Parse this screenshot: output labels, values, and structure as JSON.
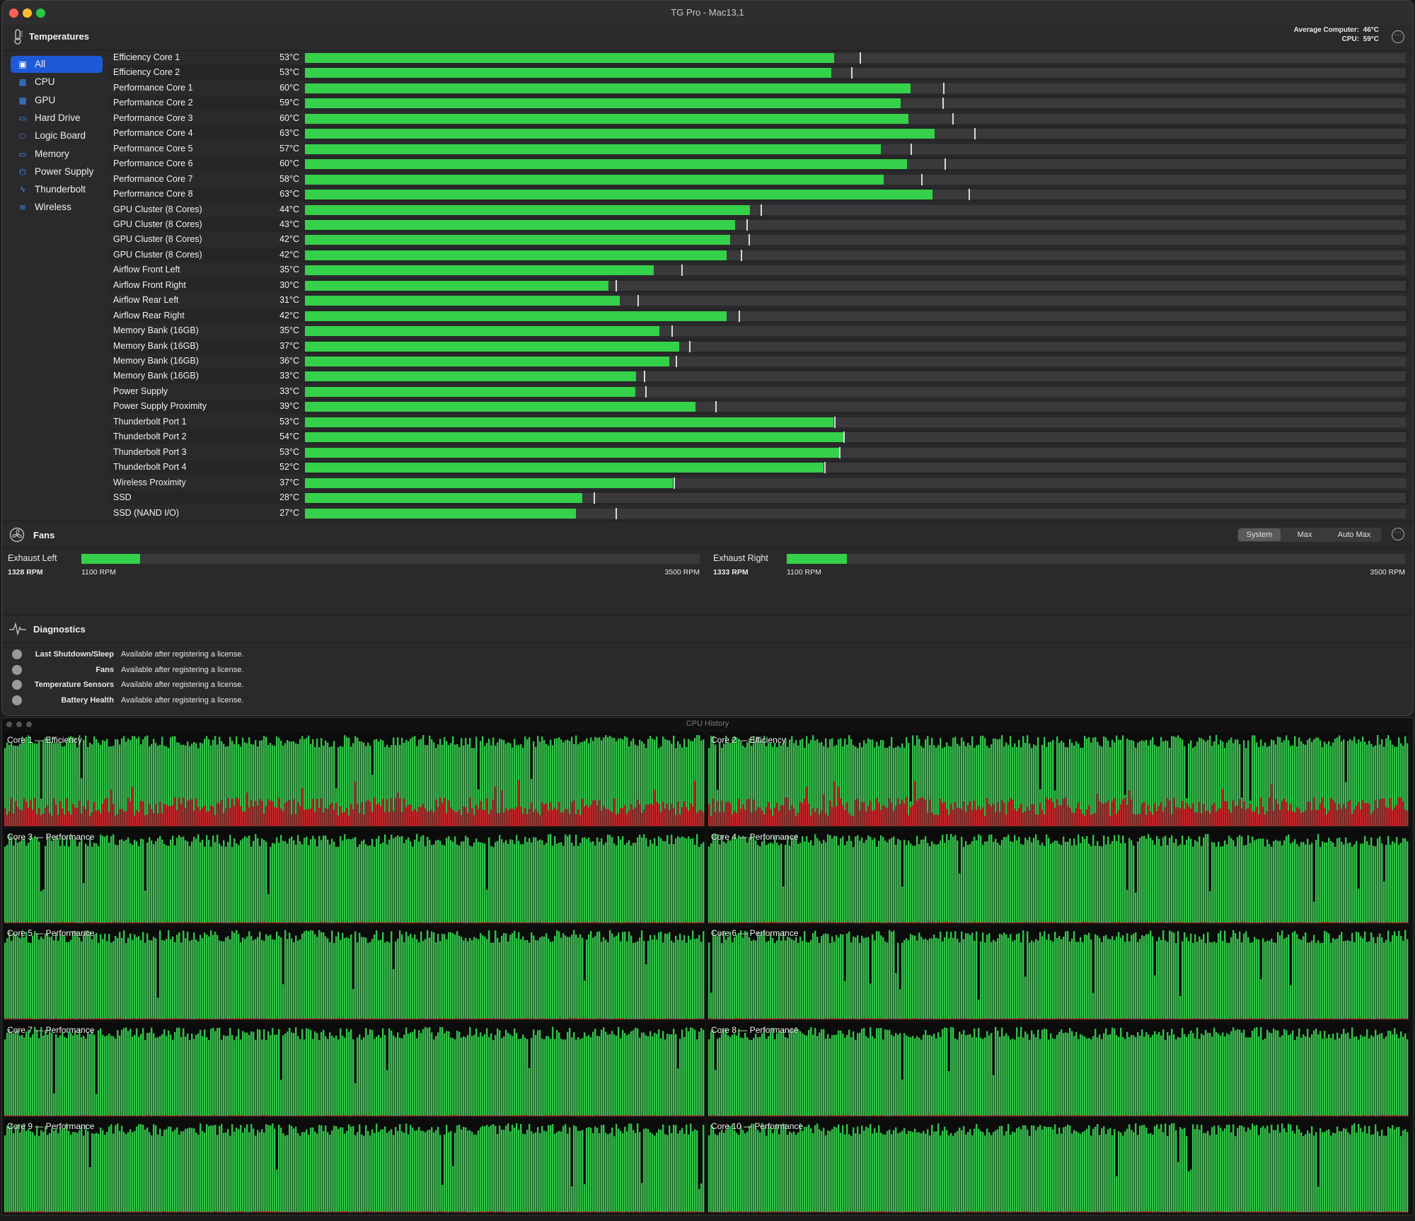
{
  "window": {
    "title": "TG Pro - Mac13,1"
  },
  "temperatures": {
    "header": "Temperatures",
    "avg_computer_label": "Average Computer:",
    "avg_computer_value": "46°C",
    "cpu_label": "CPU:",
    "cpu_value": "59°C",
    "categories": [
      {
        "label": "All",
        "icon": "all-icon",
        "selected": true
      },
      {
        "label": "CPU",
        "icon": "cpu-icon"
      },
      {
        "label": "GPU",
        "icon": "gpu-icon"
      },
      {
        "label": "Hard Drive",
        "icon": "hard-drive-icon"
      },
      {
        "label": "Logic Board",
        "icon": "logic-board-icon"
      },
      {
        "label": "Memory",
        "icon": "memory-icon"
      },
      {
        "label": "Power Supply",
        "icon": "power-icon"
      },
      {
        "label": "Thunderbolt",
        "icon": "thunderbolt-icon"
      },
      {
        "label": "Wireless",
        "icon": "wifi-icon"
      }
    ],
    "sensors": [
      {
        "name": "Efficiency Core 1",
        "value": "53°C",
        "level": 0.481,
        "max_mark": 0.504
      },
      {
        "name": "Efficiency Core 2",
        "value": "53°C",
        "level": 0.478,
        "max_mark": 0.496
      },
      {
        "name": "Performance Core 1",
        "value": "60°C",
        "level": 0.55,
        "max_mark": 0.58
      },
      {
        "name": "Performance Core 2",
        "value": "59°C",
        "level": 0.541,
        "max_mark": 0.579
      },
      {
        "name": "Performance Core 3",
        "value": "60°C",
        "level": 0.548,
        "max_mark": 0.588
      },
      {
        "name": "Performance Core 4",
        "value": "63°C",
        "level": 0.572,
        "max_mark": 0.608
      },
      {
        "name": "Performance Core 5",
        "value": "57°C",
        "level": 0.523,
        "max_mark": 0.55
      },
      {
        "name": "Performance Core 6",
        "value": "60°C",
        "level": 0.547,
        "max_mark": 0.581
      },
      {
        "name": "Performance Core 7",
        "value": "58°C",
        "level": 0.526,
        "max_mark": 0.56
      },
      {
        "name": "Performance Core 8",
        "value": "63°C",
        "level": 0.57,
        "max_mark": 0.603
      },
      {
        "name": "GPU Cluster (8 Cores)",
        "value": "44°C",
        "level": 0.404,
        "max_mark": 0.414
      },
      {
        "name": "GPU Cluster (8 Cores)",
        "value": "43°C",
        "level": 0.391,
        "max_mark": 0.401
      },
      {
        "name": "GPU Cluster (8 Cores)",
        "value": "42°C",
        "level": 0.386,
        "max_mark": 0.403
      },
      {
        "name": "GPU Cluster (8 Cores)",
        "value": "42°C",
        "level": 0.383,
        "max_mark": 0.396
      },
      {
        "name": "Airflow Front Left",
        "value": "35°C",
        "level": 0.317,
        "max_mark": 0.342
      },
      {
        "name": "Airflow Front Right",
        "value": "30°C",
        "level": 0.276,
        "max_mark": 0.282
      },
      {
        "name": "Airflow Rear Left",
        "value": "31°C",
        "level": 0.286,
        "max_mark": 0.302
      },
      {
        "name": "Airflow Rear Right",
        "value": "42°C",
        "level": 0.383,
        "max_mark": 0.394
      },
      {
        "name": "Memory Bank (16GB)",
        "value": "35°C",
        "level": 0.322,
        "max_mark": 0.333
      },
      {
        "name": "Memory Bank (16GB)",
        "value": "37°C",
        "level": 0.34,
        "max_mark": 0.349
      },
      {
        "name": "Memory Bank (16GB)",
        "value": "36°C",
        "level": 0.331,
        "max_mark": 0.337
      },
      {
        "name": "Memory Bank (16GB)",
        "value": "33°C",
        "level": 0.301,
        "max_mark": 0.308
      },
      {
        "name": "Power Supply",
        "value": "33°C",
        "level": 0.3,
        "max_mark": 0.309
      },
      {
        "name": "Power Supply Proximity",
        "value": "39°C",
        "level": 0.355,
        "max_mark": 0.373
      },
      {
        "name": "Thunderbolt Port 1",
        "value": "53°C",
        "level": 0.48,
        "max_mark": 0.481
      },
      {
        "name": "Thunderbolt Port 2",
        "value": "54°C",
        "level": 0.489,
        "max_mark": 0.489
      },
      {
        "name": "Thunderbolt Port 3",
        "value": "53°C",
        "level": 0.485,
        "max_mark": 0.485
      },
      {
        "name": "Thunderbolt Port 4",
        "value": "52°C",
        "level": 0.471,
        "max_mark": 0.472
      },
      {
        "name": "Wireless Proximity",
        "value": "37°C",
        "level": 0.334,
        "max_mark": 0.335
      },
      {
        "name": "SSD",
        "value": "28°C",
        "level": 0.252,
        "max_mark": 0.262
      },
      {
        "name": "SSD (NAND I/O)",
        "value": "27°C",
        "level": 0.246,
        "max_mark": 0.282
      }
    ]
  },
  "fans": {
    "header": "Fans",
    "modes": [
      "System",
      "Max",
      "Auto Max"
    ],
    "selected_mode": "System",
    "items": [
      {
        "name": "Exhaust Left",
        "rpm": "1328 RPM",
        "min": "1100 RPM",
        "max": "3500 RPM",
        "level": 0.095
      },
      {
        "name": "Exhaust Right",
        "rpm": "1333 RPM",
        "min": "1100 RPM",
        "max": "3500 RPM",
        "level": 0.097
      }
    ]
  },
  "diagnostics": {
    "header": "Diagnostics",
    "items": [
      {
        "label": "Last Shutdown/Sleep",
        "text": "Available after registering a license."
      },
      {
        "label": "Fans",
        "text": "Available after registering a license."
      },
      {
        "label": "Temperature Sensors",
        "text": "Available after registering a license."
      },
      {
        "label": "Battery Health",
        "text": "Available after registering a license."
      }
    ]
  },
  "cpu_history": {
    "title": "CPU History",
    "colors": {
      "user": "#33c24a",
      "system": "#c0282c",
      "idle": "#0c0c0c"
    },
    "cores": [
      {
        "label": "Core 1 — Efficiency",
        "avg_usage": 0.9,
        "system_share": 0.22
      },
      {
        "label": "Core 2 — Efficiency",
        "avg_usage": 0.9,
        "system_share": 0.22
      },
      {
        "label": "Core 3 — Performance",
        "avg_usage": 0.88,
        "system_share": 0.01
      },
      {
        "label": "Core 4 — Performance",
        "avg_usage": 0.88,
        "system_share": 0.01
      },
      {
        "label": "Core 5 — Performance",
        "avg_usage": 0.88,
        "system_share": 0.01
      },
      {
        "label": "Core 6 — Performance",
        "avg_usage": 0.88,
        "system_share": 0.01
      },
      {
        "label": "Core 7 — Performance",
        "avg_usage": 0.88,
        "system_share": 0.01
      },
      {
        "label": "Core 8 — Performance",
        "avg_usage": 0.88,
        "system_share": 0.01
      },
      {
        "label": "Core 9 — Performance",
        "avg_usage": 0.88,
        "system_share": 0.01
      },
      {
        "label": "Core 10 — Performance",
        "avg_usage": 0.88,
        "system_share": 0.01
      }
    ]
  }
}
